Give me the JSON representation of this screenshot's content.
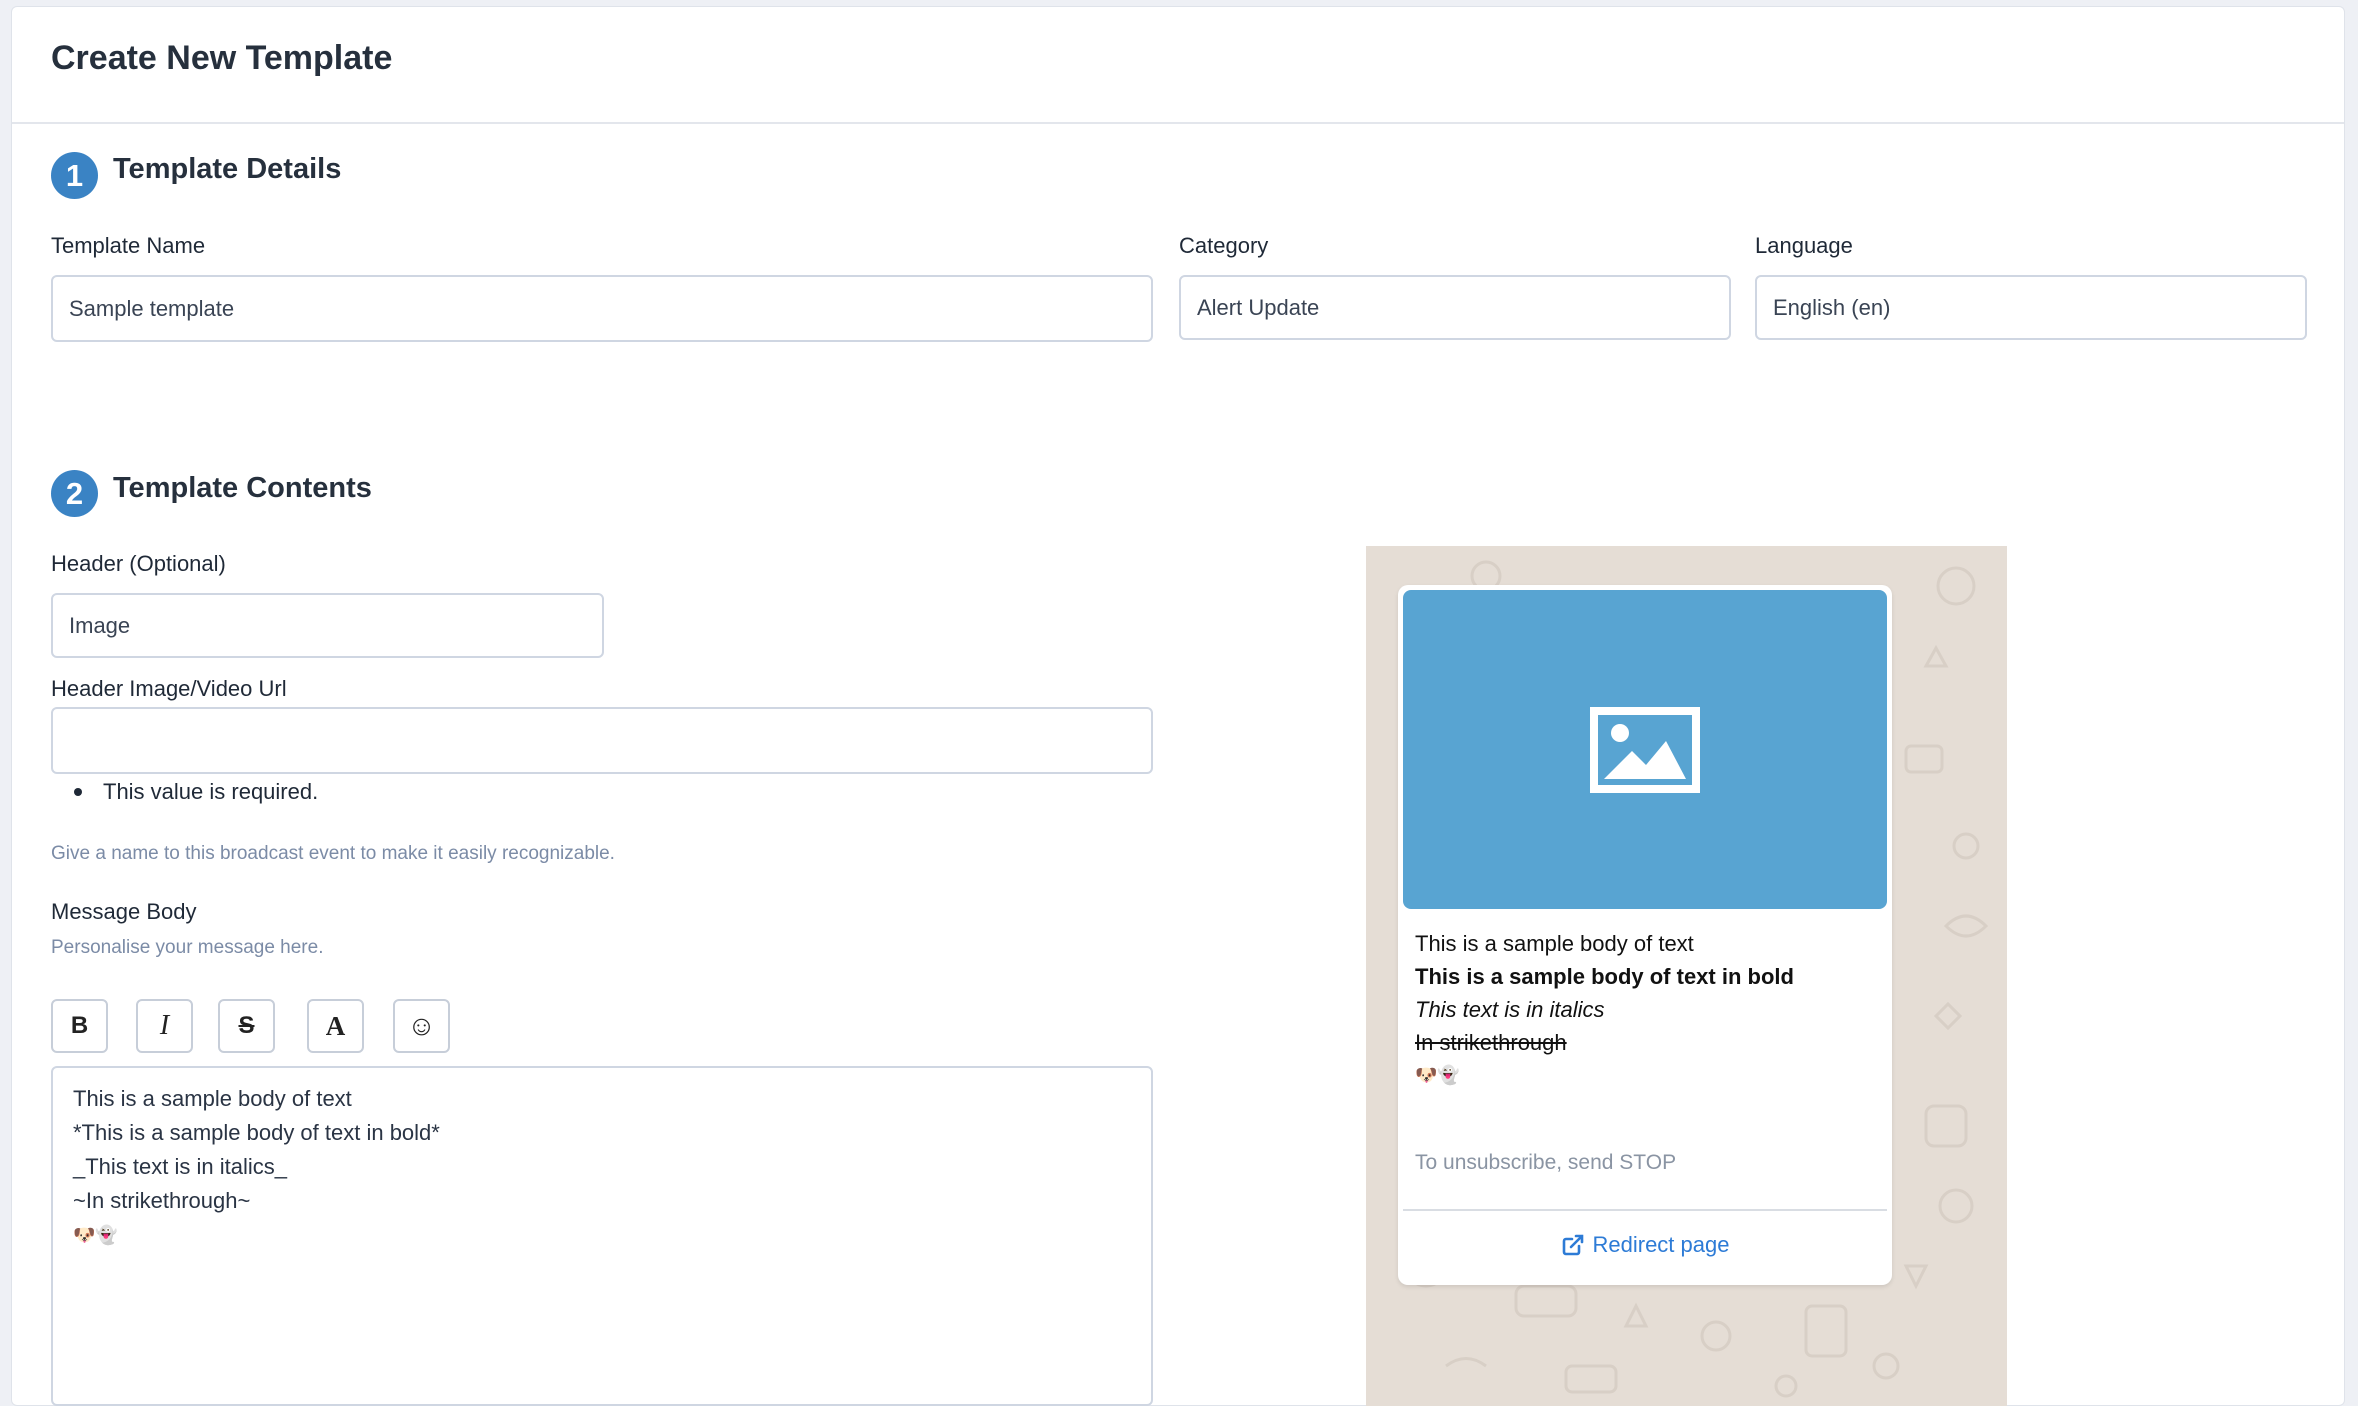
{
  "page": {
    "title": "Create New Template"
  },
  "details": {
    "step": "1",
    "title": "Template Details",
    "name_label": "Template Name",
    "name_value": "Sample template",
    "category_label": "Category",
    "category_value": "Alert Update",
    "language_label": "Language",
    "language_value": "English (en)"
  },
  "contents": {
    "step": "2",
    "title": "Template Contents",
    "header_label": "Header (Optional)",
    "header_value": "Image",
    "url_label": "Header Image/Video Url",
    "url_value": "",
    "url_error": "This value is required.",
    "url_help": "Give a name to this broadcast event to make it easily recognizable.",
    "body_label": "Message Body",
    "body_help": "Personalise your message here.",
    "toolbar": {
      "bold": "B",
      "italic": "I",
      "strike": "S",
      "font": "A",
      "emoji": "☺"
    },
    "body_lines": [
      "This is a sample body of text",
      "*This is a sample body of text in bold*",
      "_This text is in italics_",
      "~In strikethrough~",
      "🐶👻"
    ]
  },
  "preview": {
    "lines": [
      "This is a sample body of text",
      "This is a sample body of text in bold",
      "This text is in italics",
      "In strikethrough",
      "🐶👻"
    ],
    "footer": "To unsubscribe, send STOP",
    "button_label": "Redirect page",
    "image_icon": "image-placeholder-icon",
    "link_icon": "external-link-icon"
  },
  "colors": {
    "accent": "#3a83c4",
    "preview_bg": "#e5ddd5",
    "image_placeholder": "#58a4d2",
    "link": "#2d7bd6"
  }
}
